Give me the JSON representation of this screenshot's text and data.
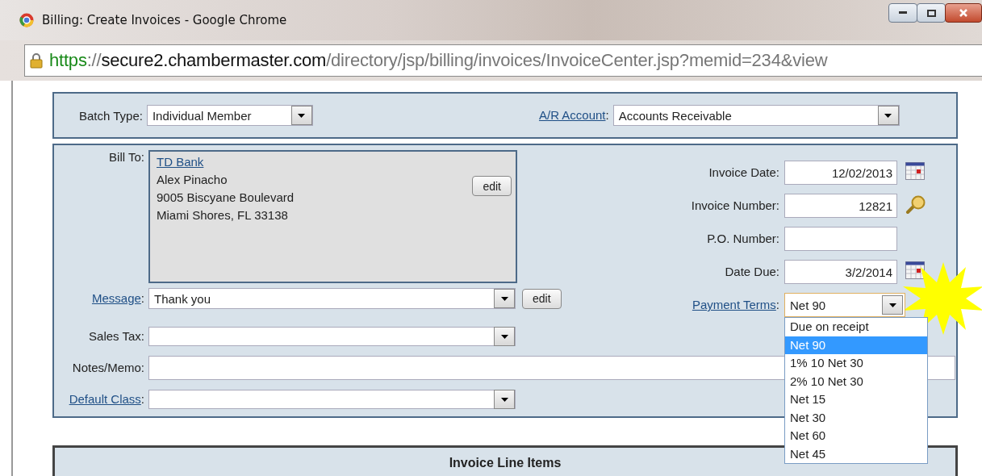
{
  "window": {
    "title": "Billing: Create Invoices - Google Chrome"
  },
  "address_bar": {
    "scheme": "https",
    "separator": "://",
    "host": "secure2.chambermaster.com",
    "path": "/directory/jsp/billing/invoices/InvoiceCenter.jsp?memid=234&view"
  },
  "batch": {
    "batch_type": {
      "label": "Batch Type:",
      "value": "Individual Member"
    },
    "ar_account": {
      "label": "A/R Account",
      "suffix": ":",
      "value": "Accounts Receivable"
    }
  },
  "bill_to": {
    "label": "Bill To:",
    "name": "TD Bank",
    "lines": [
      "Alex Pinacho",
      "9005 Biscyane Boulevard",
      "Miami Shores, FL 33138"
    ],
    "button": "edit"
  },
  "message": {
    "label": "Message",
    "suffix": ":",
    "value": "Thank you",
    "button": "edit"
  },
  "right_fields": [
    {
      "label": "Invoice Date:",
      "value": "12/02/2013",
      "kind": "date"
    },
    {
      "label": "Invoice Number:",
      "value": "12821",
      "kind": "lookup"
    },
    {
      "label": "P.O. Number:",
      "kind": "text"
    },
    {
      "label": "Date Due:",
      "value": "3/2/2014",
      "kind": "date"
    }
  ],
  "payment_terms": {
    "label": "Payment Terms",
    "suffix": ":",
    "value": "Net 90",
    "expanded": true,
    "options": [
      {
        "label": "Due on receipt",
        "selected": false
      },
      {
        "label": "Net 90",
        "selected": true
      },
      {
        "label": "1% 10 Net 30",
        "selected": false
      },
      {
        "label": "2% 10 Net 30",
        "selected": false
      },
      {
        "label": "Net 15",
        "selected": false
      },
      {
        "label": "Net 30",
        "selected": false
      },
      {
        "label": "Net 60",
        "selected": false
      },
      {
        "label": "Net 45",
        "selected": false
      }
    ]
  },
  "lower_fields": [
    {
      "label": "Sales Tax:",
      "kind": "select"
    },
    {
      "label": "Notes/Memo:",
      "kind": "text"
    },
    {
      "label": "Default Class",
      "suffix": ":",
      "kind": "select"
    }
  ],
  "line_items": {
    "title": "Invoice Line Items"
  }
}
